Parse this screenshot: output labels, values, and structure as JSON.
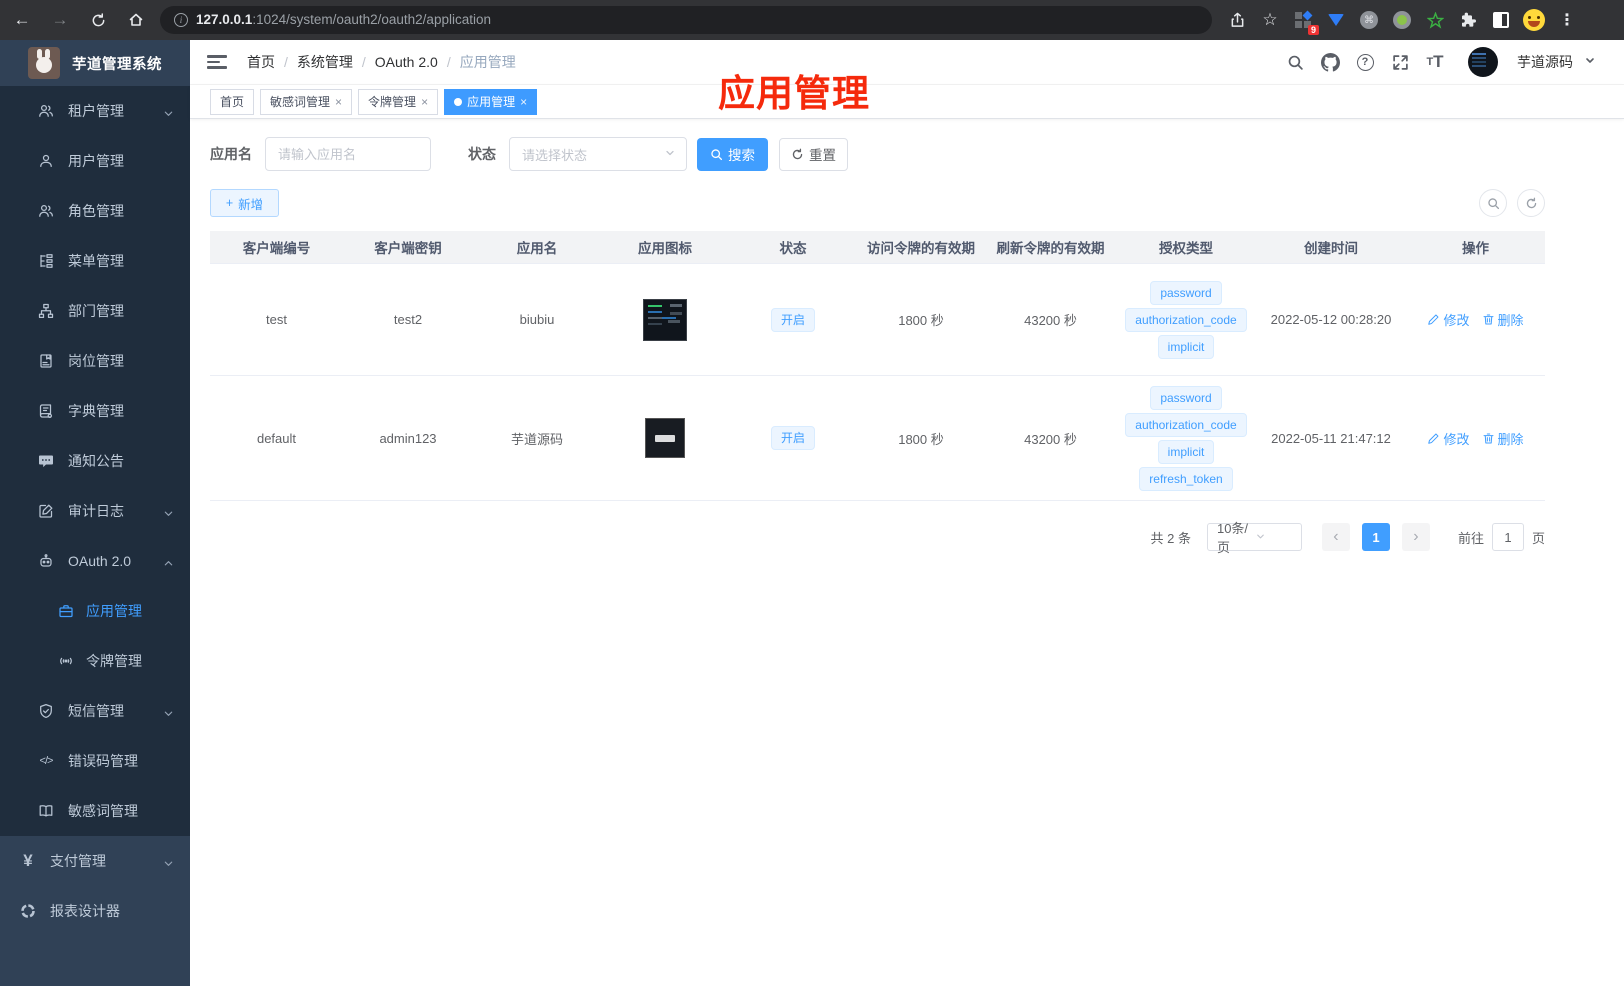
{
  "colors": {
    "primary": "#409eff",
    "sidebar_bg": "#304156",
    "submenu_bg": "#1f2d3d",
    "annotation_red": "#f52a0c",
    "tag_bg": "#ecf5ff",
    "tag_text": "#409eff",
    "active_tab_bg": "#3e9bff"
  },
  "icons": {
    "question": "?",
    "close": "×",
    "yen": "¥",
    "plus": "+",
    "code": "</>",
    "kebab": "⋮",
    "chevron_left": "‹",
    "chevron_right": "›",
    "share": "⇧",
    "star": "☆",
    "back": "←",
    "forward": "→",
    "reload": "⟳",
    "home": "⌂",
    "info": "i",
    "command": "⌘"
  },
  "browser": {
    "url_host": "127.0.0.1",
    "url_rest": ":1024/system/oauth2/oauth2/application",
    "extension_badge": "9"
  },
  "sidebar": {
    "title": "芋道管理系统",
    "items": [
      {
        "label": "租户管理"
      },
      {
        "label": "用户管理"
      },
      {
        "label": "角色管理"
      },
      {
        "label": "菜单管理"
      },
      {
        "label": "部门管理"
      },
      {
        "label": "岗位管理"
      },
      {
        "label": "字典管理"
      },
      {
        "label": "通知公告"
      },
      {
        "label": "审计日志"
      },
      {
        "label": "OAuth 2.0"
      },
      {
        "label": "应用管理"
      },
      {
        "label": "令牌管理"
      },
      {
        "label": "短信管理"
      },
      {
        "label": "错误码管理"
      },
      {
        "label": "敏感词管理"
      },
      {
        "label": "支付管理"
      },
      {
        "label": "报表设计器"
      }
    ]
  },
  "header": {
    "breadcrumb": [
      "首页",
      "系统管理",
      "OAuth 2.0",
      "应用管理"
    ],
    "user_name": "芋道源码"
  },
  "annotation": "应用管理",
  "tabs": [
    {
      "label": "首页"
    },
    {
      "label": "敏感词管理"
    },
    {
      "label": "令牌管理"
    },
    {
      "label": "应用管理"
    }
  ],
  "filters": {
    "name_label": "应用名",
    "name_placeholder": "请输入应用名",
    "status_label": "状态",
    "status_placeholder": "请选择状态",
    "search_label": "搜索",
    "reset_label": "重置"
  },
  "toolbar": {
    "add_label": "新增"
  },
  "table": {
    "columns": [
      "客户端编号",
      "客户端密钥",
      "应用名",
      "应用图标",
      "状态",
      "访问令牌的有效期",
      "刷新令牌的有效期",
      "授权类型",
      "创建时间",
      "操作"
    ],
    "actions": {
      "edit": "修改",
      "delete": "删除"
    },
    "rows": [
      {
        "client_id": "test",
        "secret": "test2",
        "name": "biubiu",
        "status": "开启",
        "access_ttl": "1800 秒",
        "refresh_ttl": "43200 秒",
        "grants": [
          "password",
          "authorization_code",
          "implicit"
        ],
        "created": "2022-05-12 00:28:20"
      },
      {
        "client_id": "default",
        "secret": "admin123",
        "name": "芋道源码",
        "status": "开启",
        "access_ttl": "1800 秒",
        "refresh_ttl": "43200 秒",
        "grants": [
          "password",
          "authorization_code",
          "implicit",
          "refresh_token"
        ],
        "created": "2022-05-11 21:47:12"
      }
    ]
  },
  "pagination": {
    "total": "共 2 条",
    "page_size": "10条/页",
    "current_page": "1",
    "goto_label": "前往",
    "goto_value": "1",
    "page_unit": "页"
  }
}
